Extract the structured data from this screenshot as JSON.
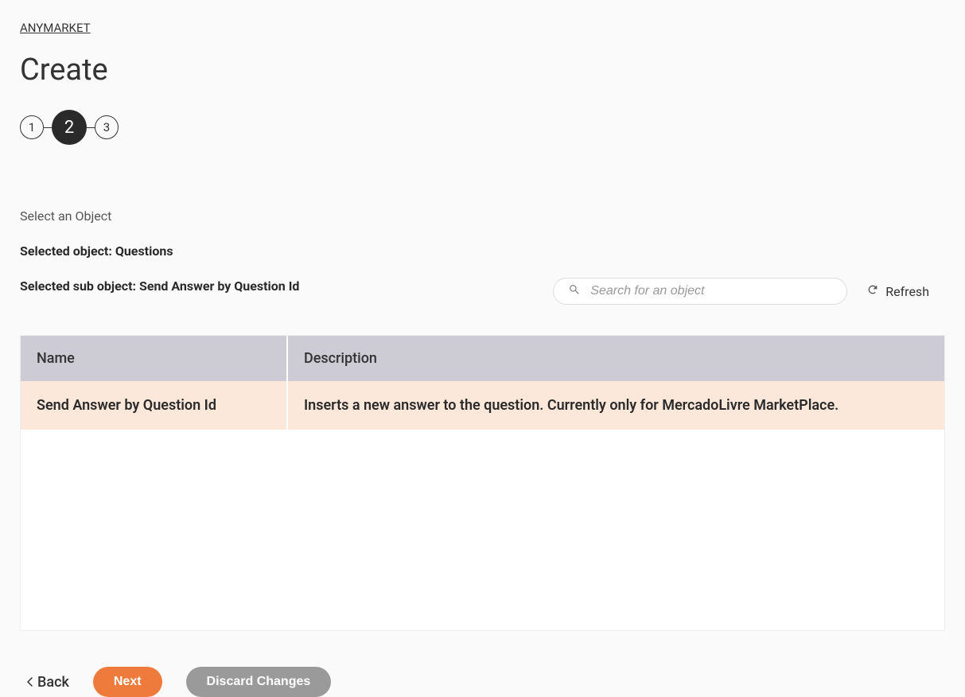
{
  "breadcrumb": {
    "label": "ANYMARKET"
  },
  "page": {
    "title": "Create"
  },
  "stepper": {
    "steps": [
      "1",
      "2",
      "3"
    ],
    "activeIndex": 1
  },
  "section": {
    "label": "Select an Object",
    "selectedObjectLine": "Selected object: Questions",
    "selectedSubObjectLine": "Selected sub object: Send Answer by Question Id"
  },
  "search": {
    "placeholder": "Search for an object"
  },
  "refresh": {
    "label": "Refresh"
  },
  "table": {
    "headers": {
      "name": "Name",
      "description": "Description"
    },
    "rows": [
      {
        "name": "Send Answer by Question Id",
        "description": "Inserts a new answer to the question. Currently only for MercadoLivre MarketPlace.",
        "selected": true
      }
    ]
  },
  "actions": {
    "back": "Back",
    "next": "Next",
    "discard": "Discard Changes"
  }
}
